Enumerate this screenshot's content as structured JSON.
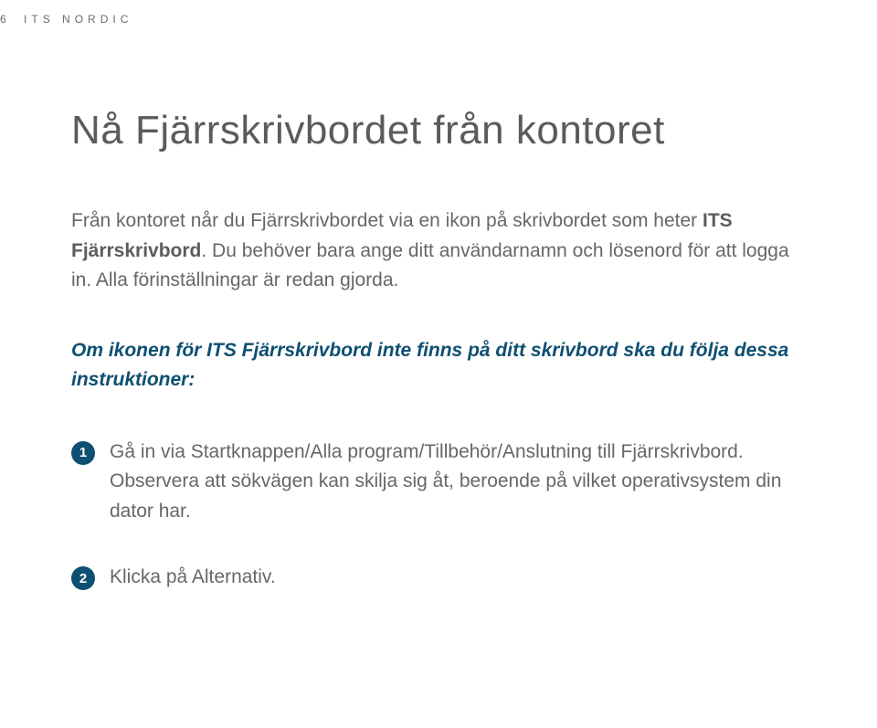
{
  "header": {
    "page_num": "6",
    "brand": "ITS NORDIC"
  },
  "title": "Nå Fjärrskrivbordet från kontoret",
  "intro": {
    "part1": "Från kontoret når du Fjärrskrivbordet via en ikon på skrivbordet som heter ",
    "bold": "ITS Fjärrskrivbord",
    "part2": ". Du behöver bara ange ditt användarnamn och lösenord för att logga in. Alla förinställningar är redan gjorda."
  },
  "subhead": "Om ikonen för ITS Fjärrskrivbord inte finns på ditt skrivbord ska du följa dessa instruktioner:",
  "steps": [
    {
      "num": "1",
      "text": "Gå in via Startknappen/Alla program/Tillbehör/Anslutning till Fjärrskrivbord. Observera att sökvägen kan skilja sig åt, beroende på vilket operativsystem din dator har."
    },
    {
      "num": "2",
      "text": "Klicka på Alternativ."
    }
  ]
}
